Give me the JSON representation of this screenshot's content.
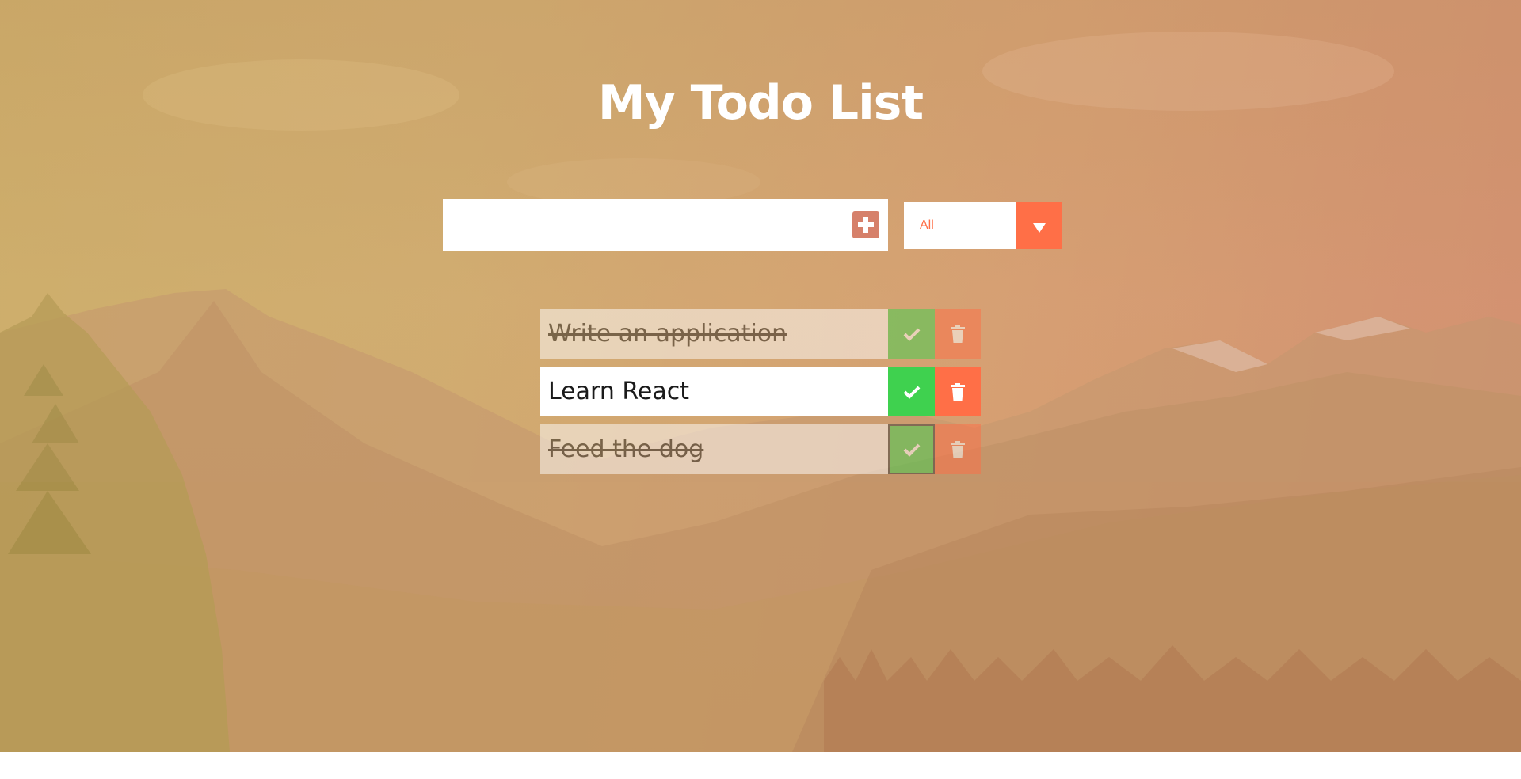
{
  "app": {
    "title": "My Todo List"
  },
  "add_form": {
    "input_value": "",
    "input_placeholder": "",
    "add_icon": "plus-icon"
  },
  "filter": {
    "selected": "All",
    "arrow_icon": "caret-down-icon"
  },
  "todos": [
    {
      "text": "Write an application",
      "completed": true
    },
    {
      "text": "Learn React",
      "completed": false
    },
    {
      "text": "Feed the dog",
      "completed": true
    }
  ],
  "icons": {
    "complete": "check-icon",
    "delete": "trash-icon"
  },
  "colors": {
    "accent": "#ff6f47",
    "complete": "#3fd14f",
    "add_button": "#d6806a",
    "title": "#ffffff"
  }
}
